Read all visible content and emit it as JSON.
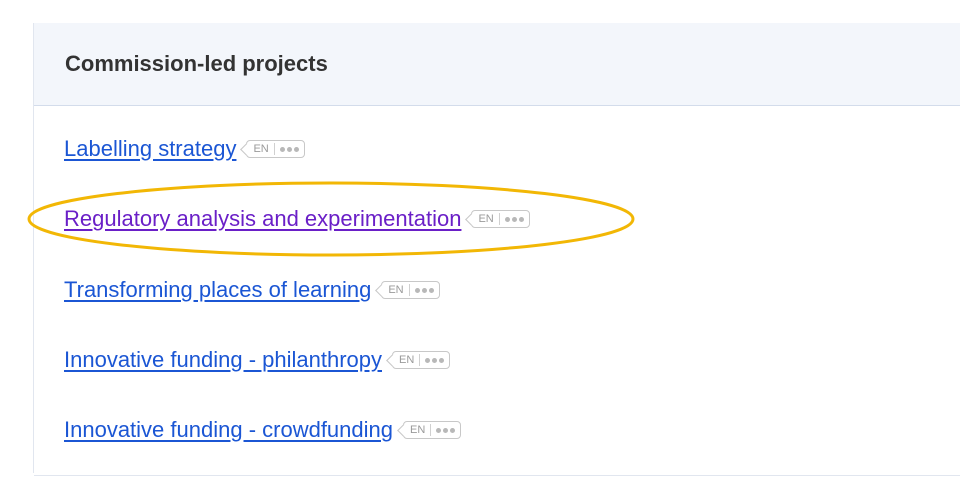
{
  "section": {
    "title": "Commission-led projects"
  },
  "items": [
    {
      "label": "Labelling strategy",
      "lang": "EN",
      "visited": false
    },
    {
      "label": "Regulatory analysis and experimentation",
      "lang": "EN",
      "visited": true
    },
    {
      "label": "Transforming places of learning",
      "lang": "EN",
      "visited": false
    },
    {
      "label": "Innovative funding - philanthropy",
      "lang": "EN",
      "visited": false
    },
    {
      "label": "Innovative funding - crowdfunding",
      "lang": "EN",
      "visited": false
    }
  ],
  "colors": {
    "link": "#1b56d4",
    "visited_link": "#6a1fc7",
    "highlight": "#f2b705",
    "header_bg": "#f3f6fb"
  },
  "icons": {
    "more_languages": "more-dots-icon",
    "highlight": "highlight-ellipse"
  }
}
